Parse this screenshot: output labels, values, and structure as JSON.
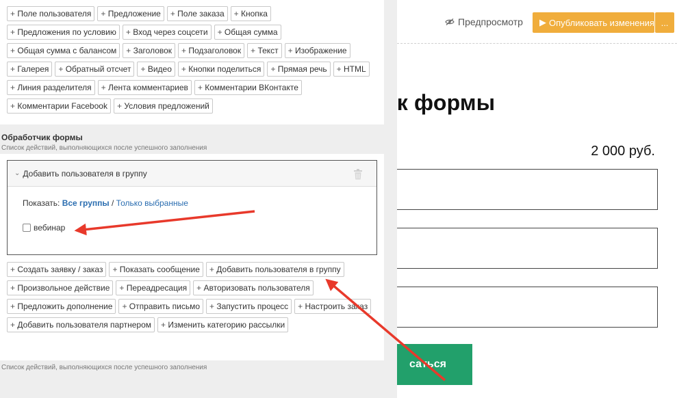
{
  "editor": {
    "field_chips": [
      "Поле пользователя",
      "Предложение",
      "Поле заказа",
      "Кнопка",
      "Предложения по условию",
      "Вход через соцсети",
      "Общая сумма",
      "Общая сумма с балансом",
      "Заголовок",
      "Подзаголовок",
      "Текст",
      "Изображение",
      "Галерея",
      "Обратный отсчет",
      "Видео",
      "Кнопки поделиться",
      "Прямая речь",
      "HTML",
      "Линия разделителя",
      "Лента комментариев",
      "Комментарии ВКонтакте",
      "Комментарии Facebook",
      "Условия предложений"
    ],
    "handler_section": {
      "title": "Обработчик формы",
      "subtitle": "Список действий, выполняющихся после успешного заполнения"
    },
    "action_card": {
      "title": "Добавить пользователя в группу",
      "show_label": "Показать:",
      "show_all": "Все группы",
      "separator": "/",
      "show_selected": "Только выбранные",
      "checkbox_label": "вебинар"
    },
    "handler_chips": [
      "Создать заявку / заказ",
      "Показать сообщение",
      "Добавить пользователя в группу",
      "Произвольное действие",
      "Переадресация",
      "Авторизовать пользователя",
      "Предложить дополнение",
      "Отправить письмо",
      "Запустить процесс",
      "Настроить заказ",
      "Добавить пользователя партнером",
      "Изменить категорию рассылки"
    ],
    "footer_subtitle": "Список действий, выполняющихся после успешного заполнения"
  },
  "preview": {
    "preview_label": "Предпросмотр",
    "publish_label": "Опубликовать изменения",
    "more_label": "...",
    "form_title_fragment": "ок формы",
    "price": "2 000 руб.",
    "submit_fragment": "саться"
  },
  "colors": {
    "accent_orange": "#f0ad3c",
    "submit_green": "#22a06b",
    "link_blue": "#2a6db0",
    "arrow_red": "#e8392b"
  },
  "icons": {
    "preview": "eye-slash-icon",
    "publish": "play-icon",
    "collapse": "chevron-down-icon",
    "delete": "trash-icon"
  }
}
